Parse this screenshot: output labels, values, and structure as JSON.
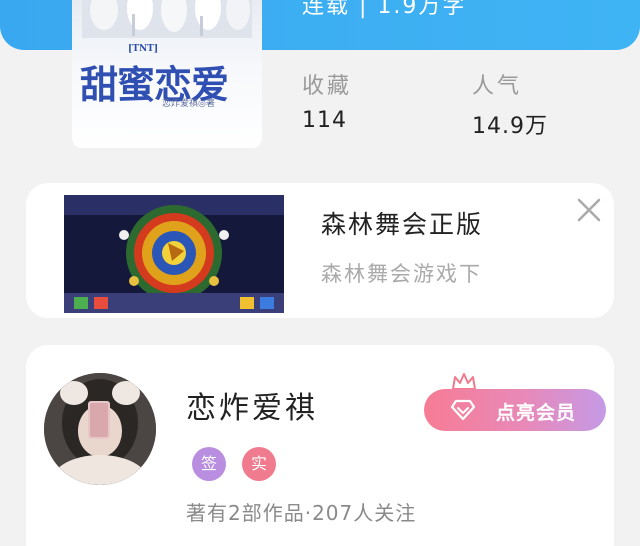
{
  "header": {
    "status_stat": "连载 | 1.9万字"
  },
  "book": {
    "cover_tag": "[TNT]",
    "cover_title": "甜蜜恋爱",
    "cover_author": "恋炸爱祺◎著",
    "stats": [
      {
        "label": "收藏",
        "value": "114"
      },
      {
        "label": "人气",
        "value": "14.9万"
      }
    ]
  },
  "ad": {
    "title": "森林舞会正版",
    "subtitle": "森林舞会游戏下",
    "close_icon": "close-icon"
  },
  "author": {
    "name": "恋炸爱祺",
    "badges": [
      {
        "text": "签",
        "color": "#b98ee0"
      },
      {
        "text": "实",
        "color": "#f07a8e"
      }
    ],
    "meta": "著有2部作品·207人关注",
    "vip_button_label": "点亮会员",
    "vip_icon": "diamond-icon",
    "crown_icon": "crown-icon"
  },
  "colors": {
    "header_blue": "#3aa8f0",
    "vip_gradient_start": "#f77c94",
    "vip_gradient_end": "#c59ae6"
  }
}
